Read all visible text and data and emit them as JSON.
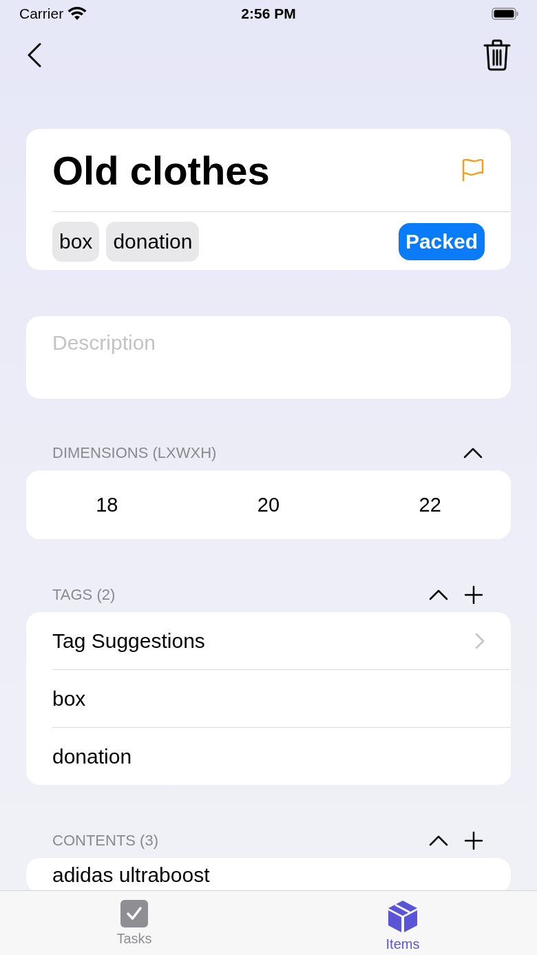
{
  "status_bar": {
    "carrier": "Carrier",
    "time": "2:56 PM"
  },
  "item": {
    "title": "Old clothes",
    "flagged": true,
    "tags": [
      "box",
      "donation"
    ],
    "status": {
      "label": "Packed",
      "on": true
    }
  },
  "description": {
    "placeholder": "Description"
  },
  "dimensions": {
    "header": "DIMENSIONS (LXWXH)",
    "expanded": true,
    "values": [
      "18",
      "20",
      "22"
    ]
  },
  "tags_section": {
    "header": "TAGS (2)",
    "expanded": true,
    "rows": [
      {
        "label": "Tag Suggestions",
        "kind": "link"
      },
      {
        "label": "box",
        "kind": "tag"
      },
      {
        "label": "donation",
        "kind": "tag"
      }
    ]
  },
  "contents_section": {
    "header": "CONTENTS (3)",
    "expanded": true,
    "rows": [
      {
        "label": "adidas ultraboost"
      }
    ]
  },
  "tab_bar": [
    {
      "label": "Tasks",
      "kind": "tasks",
      "selected": false
    },
    {
      "label": "Items",
      "kind": "items",
      "selected": true
    }
  ]
}
